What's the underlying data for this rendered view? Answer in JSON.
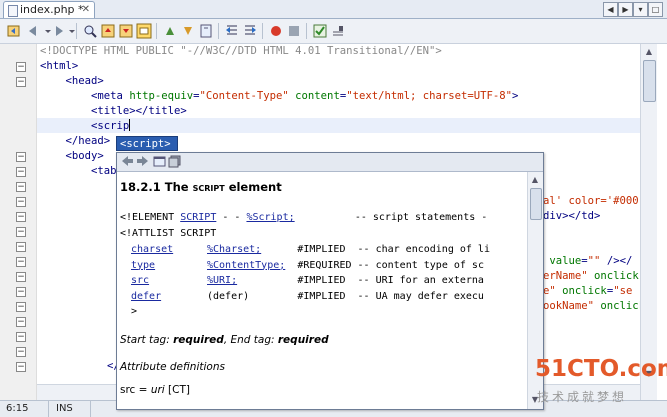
{
  "tab": {
    "title": "index.php *",
    "close": "✕"
  },
  "tab_nav": {
    "left": "◀",
    "right": "▶",
    "list": "▾",
    "maximize": "□"
  },
  "toolbar": {
    "icons": [
      "back-icon",
      "history-icon",
      "forward-icon",
      "find-icon",
      "find-previous-icon",
      "find-next-icon",
      "toggle-highlight-icon",
      "previous-bookmark-icon",
      "next-bookmark-icon",
      "toggle-bookmark-icon",
      "shift-left-icon",
      "shift-right-icon",
      "start-macro-icon",
      "stop-macro-icon",
      "check-icon",
      "comment-icon"
    ]
  },
  "code_lines": [
    [
      {
        "t": "doc",
        "v": "<!DOCTYPE HTML PUBLIC \"-//W3C//DTD HTML 4.01 Transitional//EN\">"
      }
    ],
    [
      {
        "t": "tag",
        "v": "<html>"
      }
    ],
    [
      {
        "t": "plain",
        "v": "    "
      },
      {
        "t": "tag",
        "v": "<head>"
      }
    ],
    [
      {
        "t": "plain",
        "v": "        "
      },
      {
        "t": "tag",
        "v": "<meta "
      },
      {
        "t": "attr",
        "v": "http-equiv"
      },
      {
        "t": "tag",
        "v": "="
      },
      {
        "t": "val",
        "v": "\"Content-Type\""
      },
      {
        "t": "tag",
        "v": " "
      },
      {
        "t": "attr",
        "v": "content"
      },
      {
        "t": "tag",
        "v": "="
      },
      {
        "t": "val",
        "v": "\"text/html; charset=UTF-8\""
      },
      {
        "t": "tag",
        "v": ">"
      }
    ],
    [
      {
        "t": "plain",
        "v": "        "
      },
      {
        "t": "tag",
        "v": "<title></title>"
      }
    ],
    [
      {
        "t": "plain",
        "v": "        "
      },
      {
        "t": "tag",
        "v": "<scrip"
      }
    ],
    [
      {
        "t": "plain",
        "v": "    "
      },
      {
        "t": "tag",
        "v": "</head>"
      }
    ],
    [
      {
        "t": "plain",
        "v": "    "
      },
      {
        "t": "tag",
        "v": "<body>"
      }
    ],
    [
      {
        "t": "plain",
        "v": "        "
      },
      {
        "t": "tag",
        "v": "<tab"
      }
    ]
  ],
  "right_fragments": [
    {
      "line": 10,
      "parts": [
        {
          "t": "val",
          "v": "al' color='#000"
        }
      ]
    },
    {
      "line": 11,
      "parts": [
        {
          "t": "tag",
          "v": "div></td>"
        }
      ]
    },
    {
      "line": 14,
      "parts": [
        {
          "t": "attr",
          "v": " value"
        },
        {
          "t": "tag",
          "v": "="
        },
        {
          "t": "val",
          "v": "\"\""
        },
        {
          "t": "tag",
          "v": " /></"
        }
      ]
    },
    {
      "line": 15,
      "parts": [
        {
          "t": "val",
          "v": "erName\""
        },
        {
          "t": "tag",
          "v": " "
        },
        {
          "t": "attr",
          "v": "onclick"
        }
      ]
    },
    {
      "line": 16,
      "parts": [
        {
          "t": "val",
          "v": "e\""
        },
        {
          "t": "tag",
          "v": " "
        },
        {
          "t": "attr",
          "v": "onclick"
        },
        {
          "t": "tag",
          "v": "="
        },
        {
          "t": "val",
          "v": "\"se"
        }
      ]
    },
    {
      "line": 17,
      "parts": [
        {
          "t": "val",
          "v": "ookName\""
        },
        {
          "t": "tag",
          "v": " "
        },
        {
          "t": "attr",
          "v": "onclick"
        }
      ]
    },
    {
      "line": 21,
      "parts": [
        {
          "t": "tag",
          "v": "</t"
        }
      ]
    }
  ],
  "completion": {
    "item": "<script>"
  },
  "doc": {
    "title_prefix": "18.2.1 The ",
    "title_sc": "script",
    "title_suffix": " element",
    "element_line": [
      {
        "t": "plain",
        "v": "<!ELEMENT "
      },
      {
        "t": "link",
        "v": "SCRIPT"
      },
      {
        "t": "plain",
        "v": " - - "
      },
      {
        "t": "link",
        "v": "%Script;"
      },
      {
        "t": "plain",
        "v": "          -- script statements -"
      }
    ],
    "attlist_line": "<!ATTLIST SCRIPT",
    "attrs": [
      {
        "name": "charset",
        "type": "%Charset;",
        "rest": "      #IMPLIED  -- char encoding of li"
      },
      {
        "name": "type",
        "type": "%ContentType;",
        "rest": "  #REQUIRED -- content type of sc"
      },
      {
        "name": "src",
        "type": "%URI;",
        "rest": "          #IMPLIED  -- URI for an externa"
      },
      {
        "name": "defer",
        "type": "(defer)",
        "rest": "        #IMPLIED  -- UA may defer execu"
      }
    ],
    "close": ">",
    "start_tag_pre": "Start tag: ",
    "start_tag_val": "required",
    "end_tag_pre": ", End tag: ",
    "end_tag_val": "required",
    "attr_defs": "Attribute definitions",
    "src_name": "src",
    "src_eq": " = ",
    "src_type": "uri",
    "src_ct": " [CT]"
  },
  "status": {
    "position": "6:15",
    "mode": "INS"
  },
  "watermark": {
    "main": "51CTO.com",
    "sub": "技术成就梦想"
  }
}
